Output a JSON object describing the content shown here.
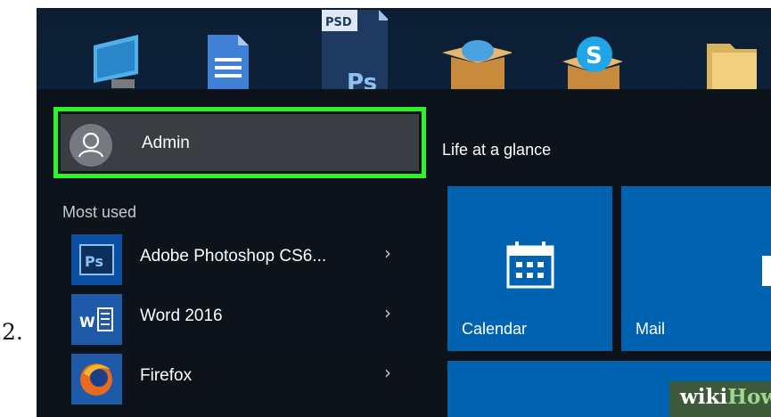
{
  "step_number": "2.",
  "start_menu": {
    "user": {
      "name": "Admin"
    },
    "most_used_label": "Most used",
    "apps": [
      {
        "label": "Adobe Photoshop CS6...",
        "icon": "photoshop-icon",
        "icon_text": "Ps"
      },
      {
        "label": "Word 2016",
        "icon": "word-icon",
        "icon_text": "W"
      },
      {
        "label": "Firefox",
        "icon": "firefox-icon"
      }
    ],
    "chevron": "›"
  },
  "live_tiles": {
    "group_title": "Life at a glance",
    "calendar_label": "Calendar",
    "mail_label": "Mail"
  },
  "desktop_icons": {
    "psd_badge": "PSD",
    "psd_text": "Ps"
  },
  "watermark": {
    "wiki": "wiki",
    "how": "How"
  },
  "colors": {
    "highlight": "#2ef52b",
    "tile_blue": "#0063b1",
    "menu_bg": "#0e1218"
  }
}
